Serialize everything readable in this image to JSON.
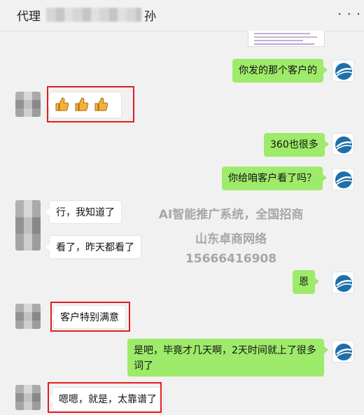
{
  "header": {
    "title_prefix": "代理",
    "title_suffix": "孙",
    "menu": "· · ·"
  },
  "messages": [
    {
      "from": "me",
      "text": "你发的那个客户的"
    },
    {
      "from": "contact",
      "type": "emoji",
      "emoji": "thumbs-up-icon",
      "count": 3
    },
    {
      "from": "me",
      "text": "360也很多"
    },
    {
      "from": "me",
      "text": "你给咱客户看了吗？"
    },
    {
      "from": "contact",
      "text": "行，我知道了"
    },
    {
      "from": "contact",
      "text": "看了，昨天都看了"
    },
    {
      "from": "me",
      "text": "恩"
    },
    {
      "from": "contact",
      "text": "客户特别满意"
    },
    {
      "from": "me",
      "text": "是吧，毕竟才几天啊，2天时间就上了很多词了"
    },
    {
      "from": "contact",
      "text": "嗯嗯，就是，太靠谱了"
    }
  ],
  "watermark": {
    "line1": "AI智能推广系统，全国招商",
    "line2": "山东卓商网络",
    "line3": "15666416908"
  },
  "colors": {
    "outgoing_bubble": "#9eea6a",
    "incoming_bubble": "#ffffff",
    "highlight": "#e11d1d",
    "background": "#f1f1f1"
  }
}
